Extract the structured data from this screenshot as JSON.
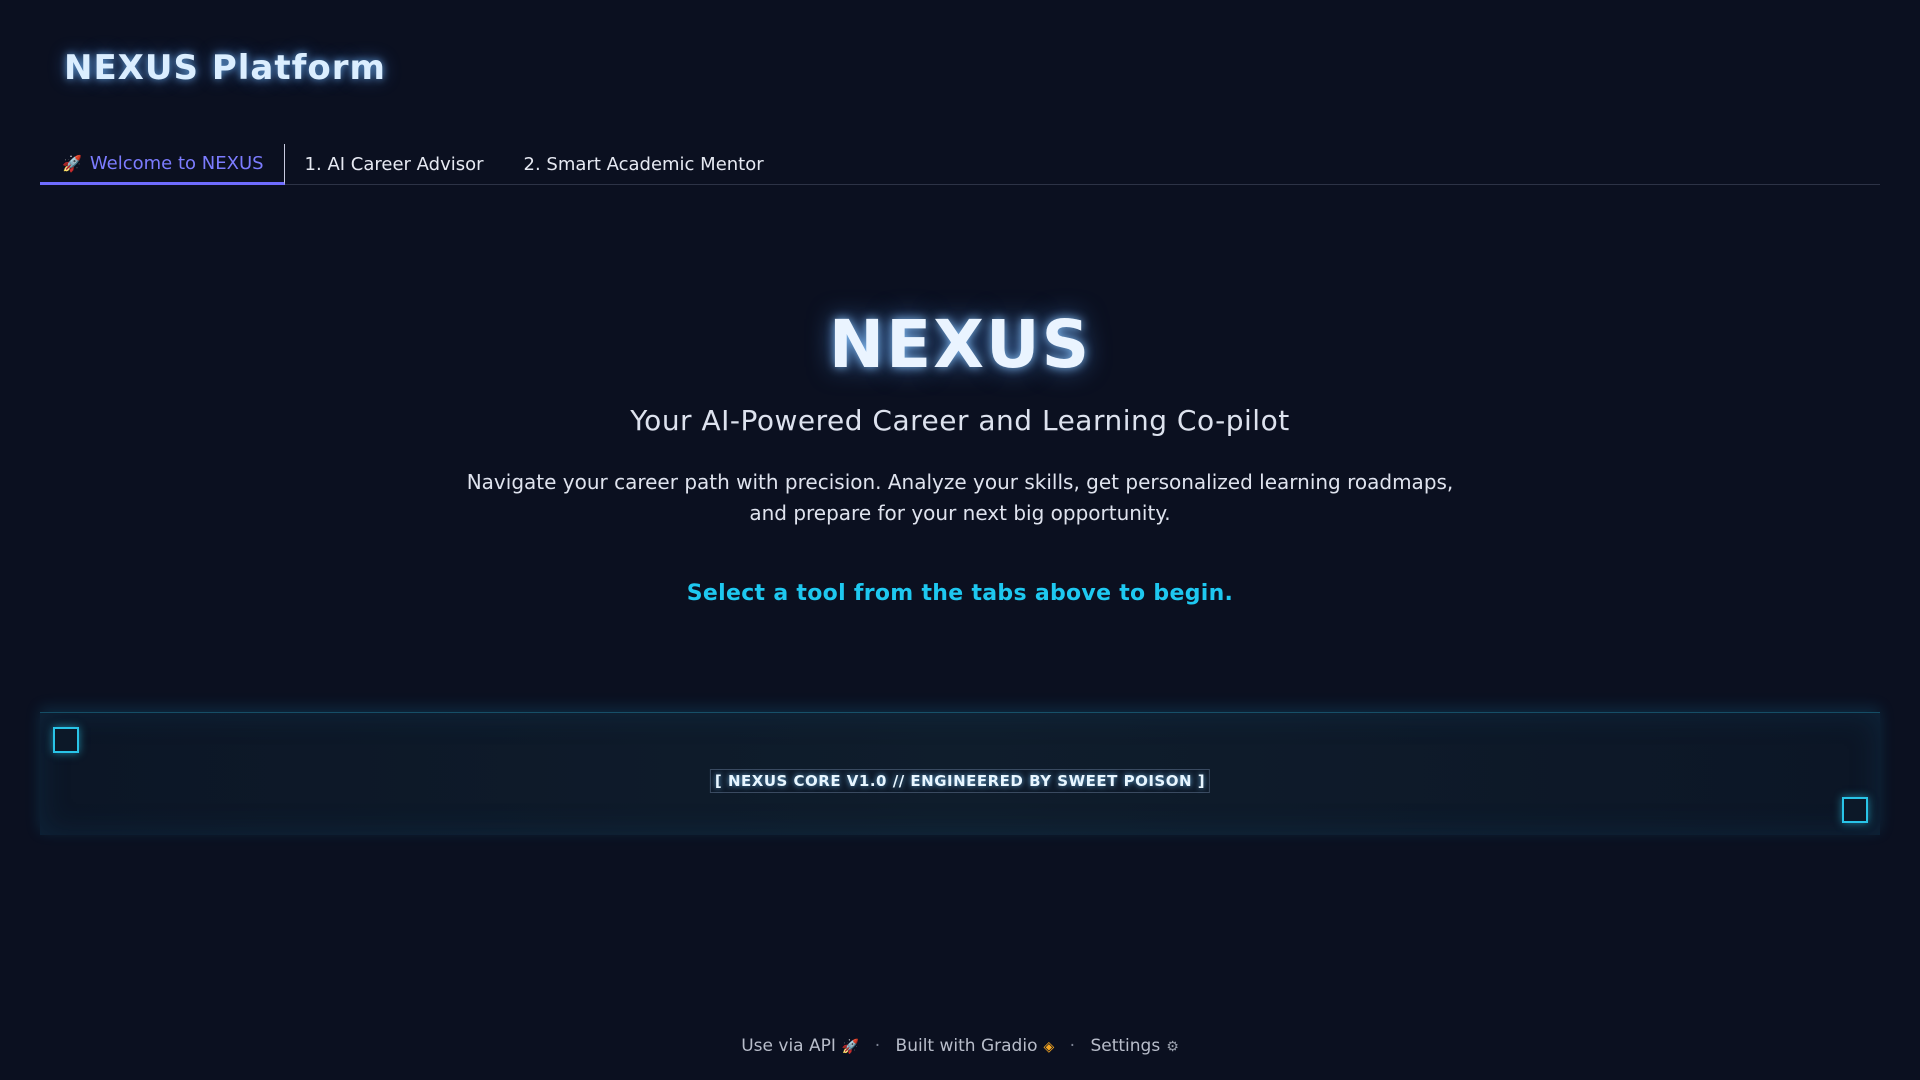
{
  "app": {
    "title": "NEXUS Platform"
  },
  "tabs": [
    {
      "label": "Welcome to NEXUS",
      "icon": "rocket-icon",
      "active": true
    },
    {
      "label": "1. AI Career Advisor",
      "active": false
    },
    {
      "label": "2. Smart Academic Mentor",
      "active": false
    }
  ],
  "hero": {
    "title": "NEXUS",
    "subtitle": "Your AI-Powered Career and Learning Co-pilot",
    "description": "Navigate your career path with precision. Analyze your skills, get personalized learning roadmaps, and prepare for your next big opportunity.",
    "cta": "Select a tool from the tabs above to begin."
  },
  "core_panel": {
    "label": "[ NEXUS CORE V1.0 // ENGINEERED BY SWEET POISON ]"
  },
  "footer": {
    "api_label": "Use via API",
    "built_label": "Built with Gradio",
    "settings_label": "Settings",
    "separator": "·"
  },
  "colors": {
    "background": "#0b1020",
    "accent_tab": "#6f6cff",
    "cta": "#1ec8f0",
    "corner": "#29c4e8"
  }
}
